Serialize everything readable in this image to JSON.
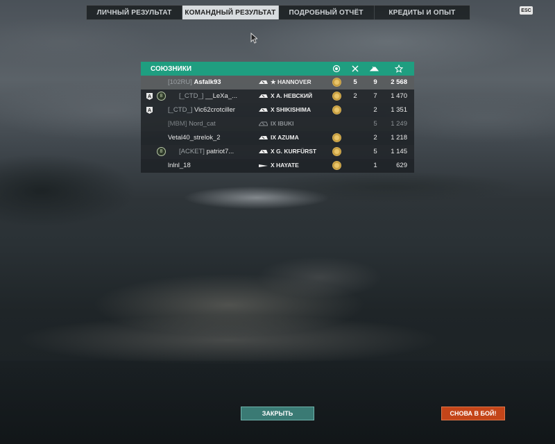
{
  "tabs": [
    {
      "label": "ЛИЧНЫЙ РЕЗУЛЬТАТ",
      "active": false
    },
    {
      "label": "КОМАНДНЫЙ РЕЗУЛЬТАТ",
      "active": true
    },
    {
      "label": "ПОДРОБНЫЙ ОТЧЁТ",
      "active": false
    },
    {
      "label": "КРЕДИТЫ И ОПЫТ",
      "active": false
    }
  ],
  "esc_label": "ESC",
  "team": {
    "title": "СОЮЗНИКИ",
    "header_icons": [
      "medal-icon",
      "frag-icon",
      "planes-icon",
      "star-icon"
    ],
    "rows": [
      {
        "clan": "[102RU]",
        "name": "Asfalk93",
        "ship": "★ HANNOVER",
        "kills": "5",
        "planes": "9",
        "xp": "2 568"
      },
      {
        "clan": "[_CTD_]",
        "name": "__LeXa_...",
        "ship": "X А. НЕВСКИЙ",
        "kills": "2",
        "planes": "7",
        "xp": "1 470",
        "division": "A",
        "rank": "8"
      },
      {
        "clan": "[_CTD_]",
        "name": "Vic62crotciller",
        "ship": "X SHIKISHIMA",
        "planes": "2",
        "xp": "1 351",
        "division": "A"
      },
      {
        "clan": "[MBM]",
        "name": "Nord_cat",
        "ship": "IX IBUKI",
        "planes": "5",
        "xp": "1 249"
      },
      {
        "name": "Vetal40_strelok_2",
        "ship": "IX AZUMA",
        "planes": "2",
        "xp": "1 218"
      },
      {
        "clan": "[ACKET]",
        "name": "patriot7...",
        "ship": "X G. KURFÜRST",
        "planes": "5",
        "xp": "1 145",
        "rank": "8"
      },
      {
        "name": "lnlnl_18",
        "ship": "X HAYATE",
        "planes": "1",
        "xp": "629"
      }
    ]
  },
  "buttons": {
    "close": "ЗАКРЫТЬ",
    "again": "СНОВА В БОЙ!"
  }
}
